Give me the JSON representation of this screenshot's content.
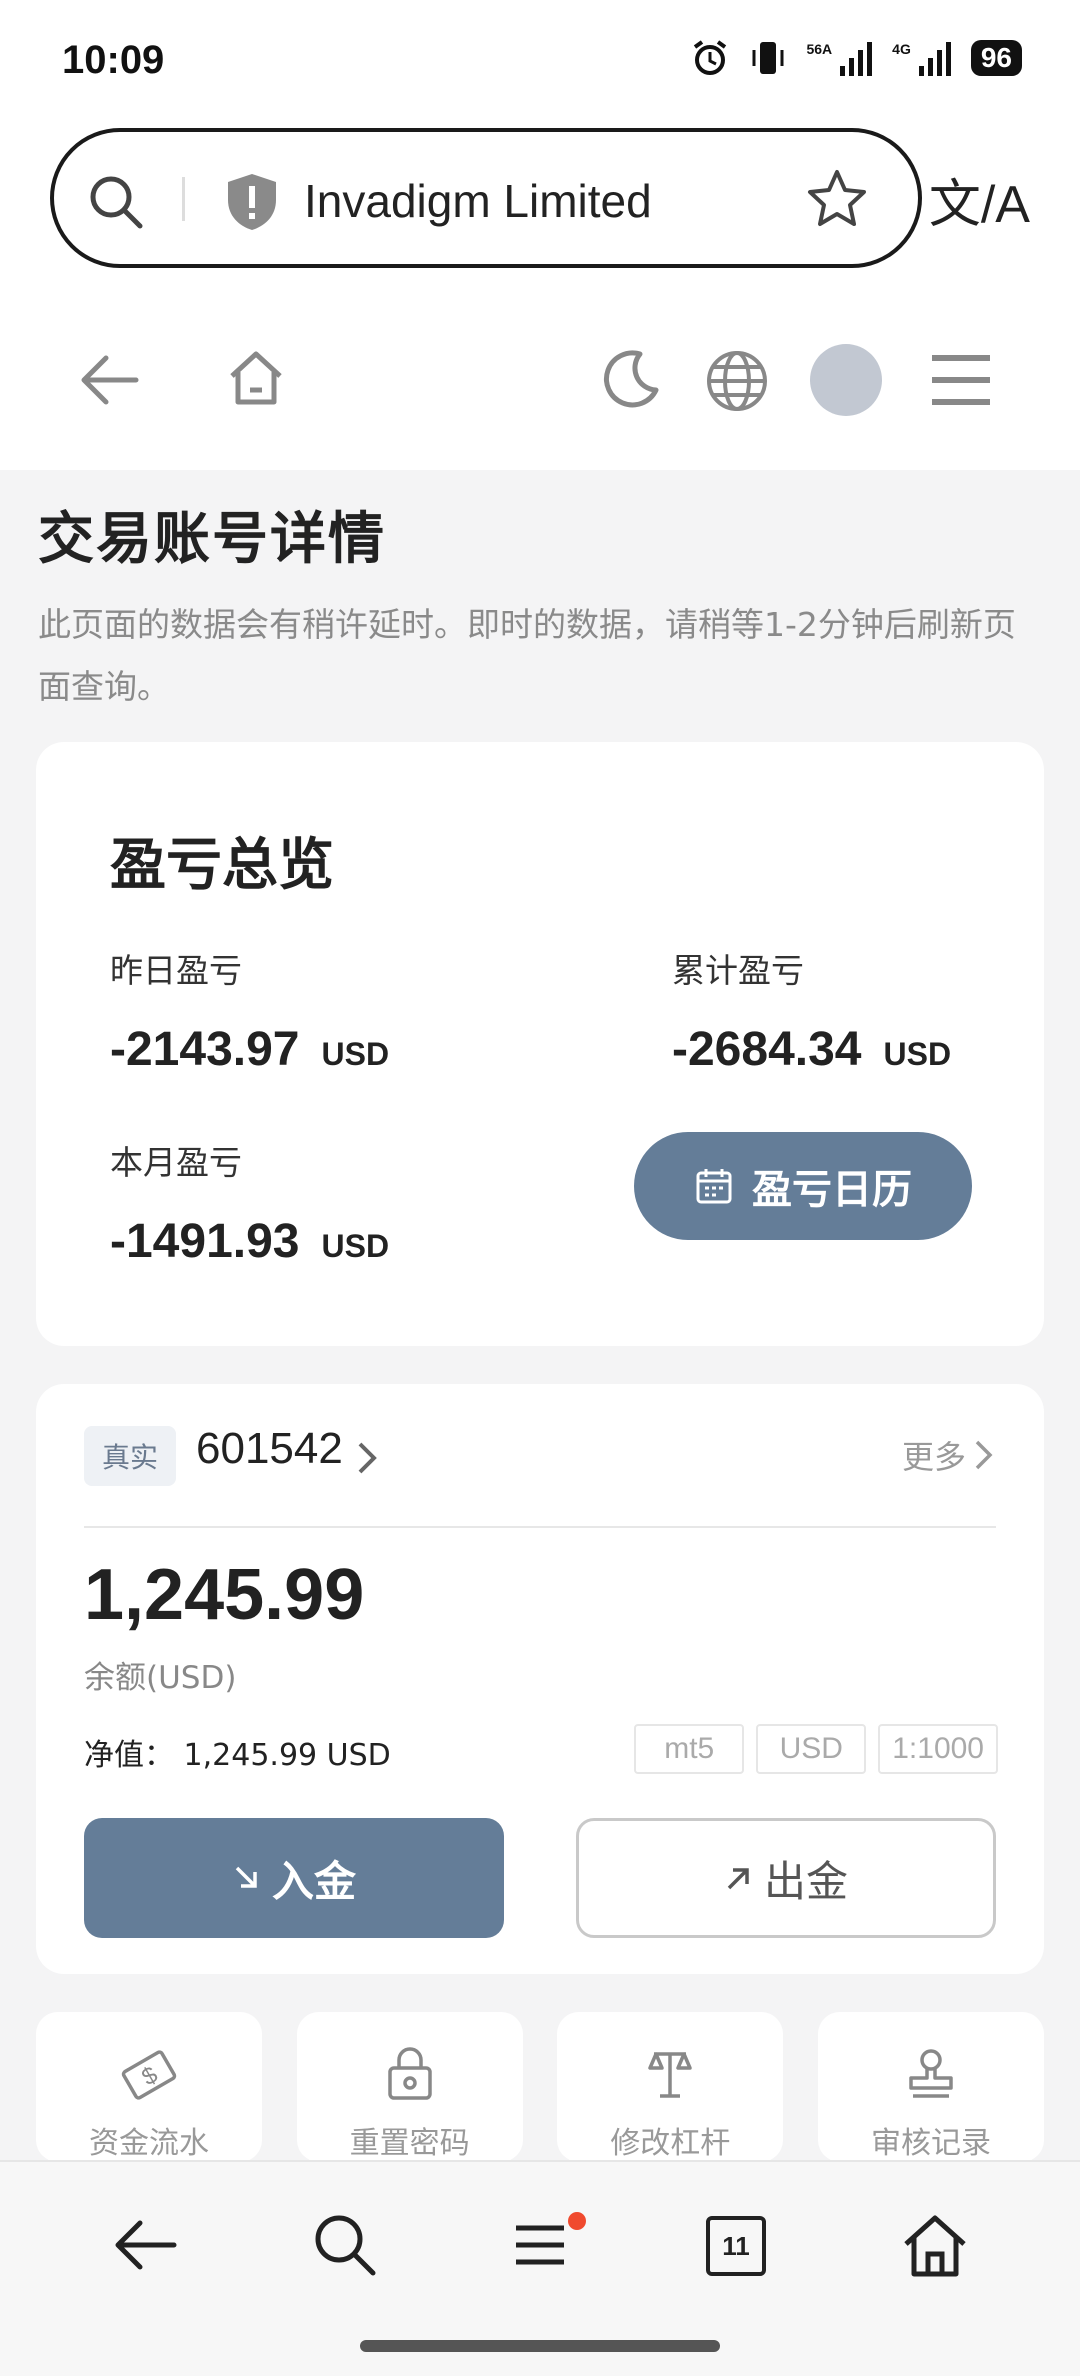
{
  "status_bar": {
    "time": "10:09",
    "net_label_1": "56A",
    "net_label_2": "4G",
    "battery": "96"
  },
  "browser": {
    "site_name": "Invadigm Limited"
  },
  "page": {
    "title": "交易账号详情",
    "notice": "此页面的数据会有稍许延时。即时的数据，请稍等1-2分钟后刷新页面查询。"
  },
  "pnl": {
    "title": "盈亏总览",
    "yesterday_label": "昨日盈亏",
    "yesterday_value": "-2143.97",
    "cumulative_label": "累计盈亏",
    "cumulative_value": "-2684.34",
    "month_label": "本月盈亏",
    "month_value": "-1491.93",
    "unit": "USD",
    "calendar_button": "盈亏日历"
  },
  "account": {
    "badge": "真实",
    "number": "601542",
    "more": "更多",
    "balance": "1,245.99",
    "balance_label": "余额(USD)",
    "equity": "净值：  1,245.99 USD",
    "tags": [
      "mt5",
      "USD",
      "1:1000"
    ],
    "deposit": "入金",
    "withdraw": "出金"
  },
  "quick_actions": [
    {
      "label": "资金流水",
      "icon": "money-icon"
    },
    {
      "label": "重置密码",
      "icon": "lock-icon"
    },
    {
      "label": "修改杠杆",
      "icon": "leverage-icon"
    },
    {
      "label": "审核记录",
      "icon": "stamp-icon"
    }
  ],
  "bottom_bar": {
    "tabs_count": "11"
  }
}
